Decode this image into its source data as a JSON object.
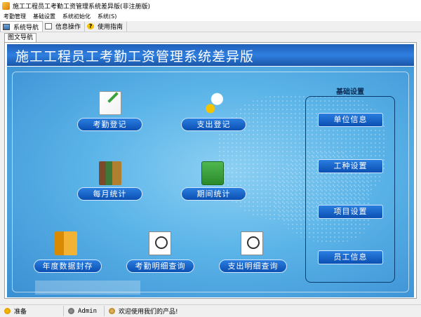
{
  "window": {
    "title": "施工工程员工考勤工资管理系统差异版(非注册版)"
  },
  "menu": [
    "考勤管理",
    "基础设置",
    "系统初始化",
    "系统(S)"
  ],
  "toolbar": [
    {
      "label": "系统导航",
      "icon": "monitor-icon"
    },
    {
      "label": "信息操作",
      "icon": "document-icon"
    },
    {
      "label": "使用指南",
      "icon": "help-icon"
    }
  ],
  "tab": {
    "label": "图文导航"
  },
  "banner": {
    "title": "施工工程员工考勤工资管理系统差异版"
  },
  "nav": {
    "attendance_register": "考勤登记",
    "expense_register": "支出登记",
    "monthly_stats": "每月统计",
    "period_stats": "期间统计",
    "annual_seal": "年度数据封存",
    "attendance_query": "考勤明细查询",
    "expense_query": "支出明细查询"
  },
  "basic_settings": {
    "title": "基础设置",
    "items": [
      "单位信息",
      "工种设置",
      "项目设置",
      "员工信息"
    ]
  },
  "status": {
    "ready": "准备",
    "user": "Admin",
    "welcome": "欢迎使用我们的产品!"
  }
}
